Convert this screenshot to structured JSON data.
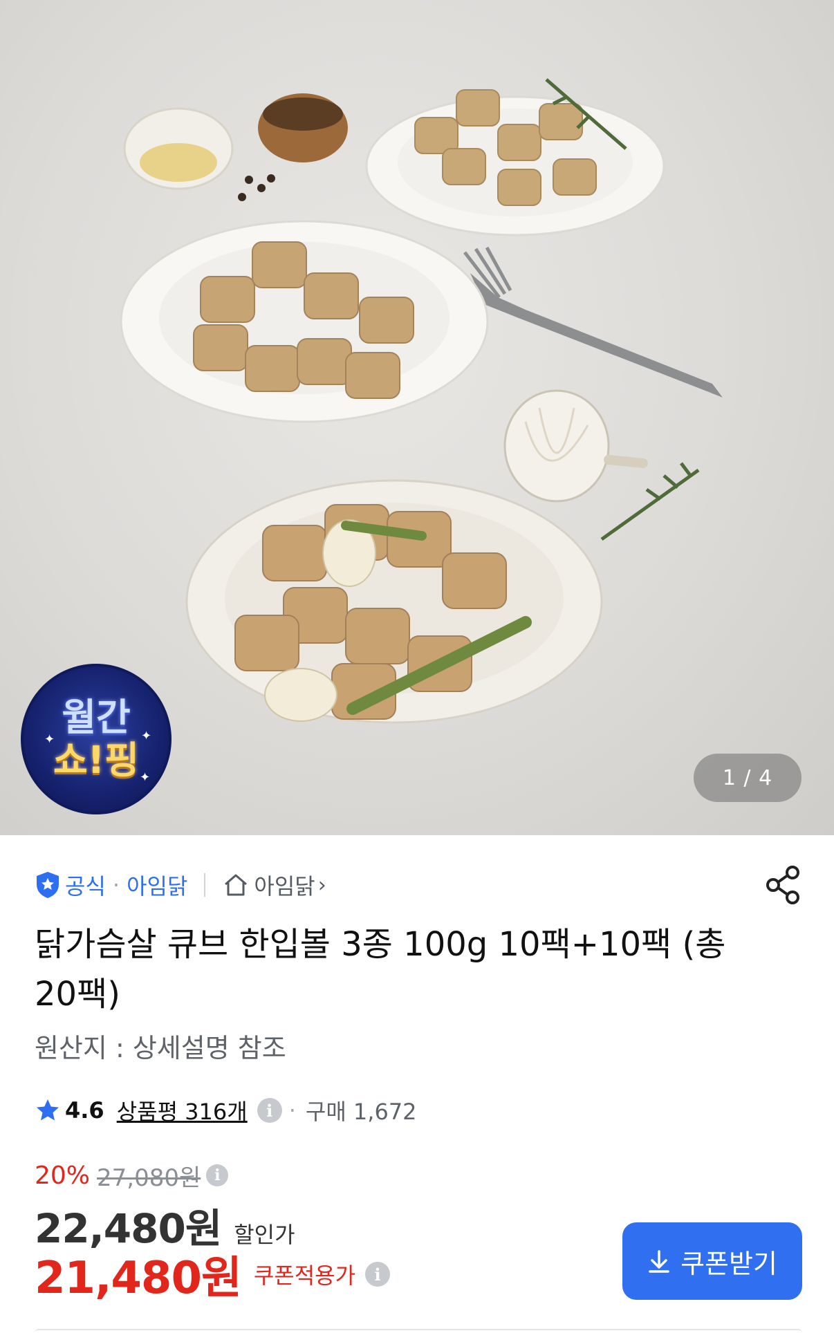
{
  "gallery": {
    "badge_line1": "월간",
    "badge_line2": "쇼!핑",
    "counter": "1 / 4"
  },
  "store": {
    "official_label": "공식",
    "brand": "아임닭",
    "shop_link": "아임닭"
  },
  "product": {
    "title": "닭가슴살 큐브 한입볼 3종 100g 10팩+10팩 (총20팩)",
    "origin": "원산지 : 상세설명 참조"
  },
  "rating": {
    "score": "4.6",
    "reviews": "상품평 316개",
    "purchases": "구매 1,672"
  },
  "price": {
    "discount_rate": "20%",
    "original": "27,080원",
    "sale": "22,480원",
    "sale_label": "할인가",
    "coupon_price": "21,480원",
    "coupon_label": "쿠폰적용가"
  },
  "actions": {
    "coupon_button": "쿠폰받기"
  },
  "colors": {
    "accent_blue": "#2f6ff0",
    "price_red": "#e1261c"
  },
  "icons": [
    "shield-badge-icon",
    "home-icon",
    "chevron-right-icon",
    "share-icon",
    "star-icon",
    "info-icon",
    "download-icon"
  ]
}
